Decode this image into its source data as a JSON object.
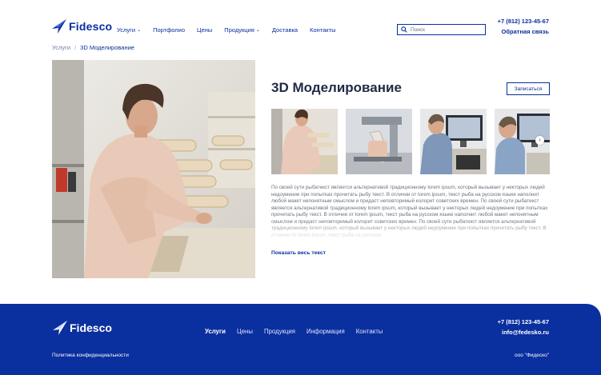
{
  "brand": {
    "name": "Fidesco",
    "accent": "#0a2f9e"
  },
  "header": {
    "nav": [
      {
        "label": "Услуги",
        "dropdown": true
      },
      {
        "label": "Портфолио",
        "dropdown": false
      },
      {
        "label": "Цены",
        "dropdown": false
      },
      {
        "label": "Продукция",
        "dropdown": true
      },
      {
        "label": "Доставка",
        "dropdown": false
      },
      {
        "label": "Контакты",
        "dropdown": false
      }
    ],
    "search_placeholder": "Поиск",
    "search_icon": "search-icon",
    "phone": "+7 (812) 123-45-67",
    "callback": "Обратная связь"
  },
  "breadcrumb": {
    "parent": "Услуги",
    "separator": "/",
    "current": "3D Моделирование"
  },
  "main": {
    "title": "3D Моделирование",
    "signup_button": "Записаться",
    "description": "По своей сути рыбатекст является альтернативой традиционному lorem ipsum, который вызывает у некторых людей недоумение при попытках прочитать рыбу текст. В отличии от lorem ipsum, текст рыба на русском языке наполнит любой макет непонятным смыслом и придаст неповторимый колорит советских времен. По своей сути рыбатекст является альтернативой традиционному lorem ipsum, который вызывает у некторых людей недоумение при попытках прочитать рыбу текст. В отличии от lorem ipsum, текст рыба на русском языке наполнит любой макет непонятным смыслом и придаст неповторимый колорит советских времен. По своей сути рыбатекст является альтернативой традиционному lorem ipsum, который вызывает у некторых людей недоумение при попытках прочитать рыбу текст. В отличии от lorem ipsum, текст рыба на русском",
    "show_all": "Показать весь текст",
    "next_arrow": "›"
  },
  "footer": {
    "nav": [
      {
        "label": "Услуги",
        "active": true
      },
      {
        "label": "Цены",
        "active": false
      },
      {
        "label": "Продукция",
        "active": false
      },
      {
        "label": "Информация",
        "active": false
      },
      {
        "label": "Контакты",
        "active": false
      }
    ],
    "phone": "+7 (812) 123-45-67",
    "email": "info@fedesko.ru",
    "privacy": "Политика конфиденциальности",
    "company": "ооо \"Фидеско\""
  }
}
